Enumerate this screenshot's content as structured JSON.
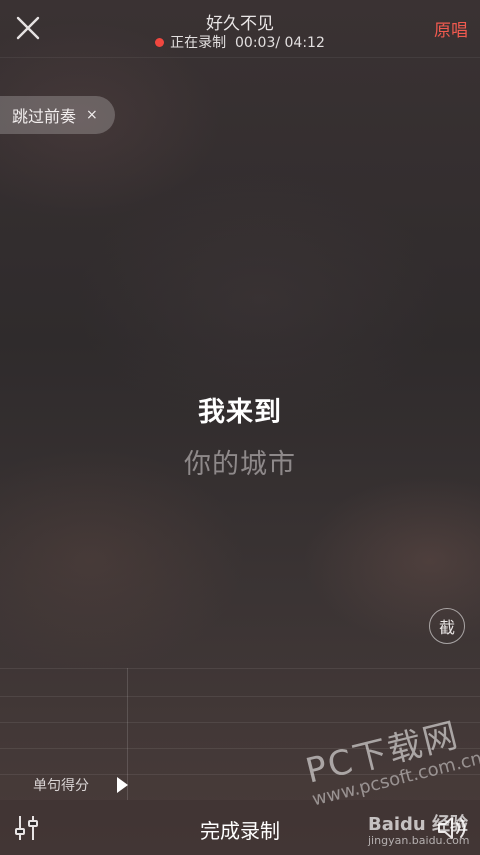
{
  "header": {
    "title": "好久不见",
    "status_label": "正在录制",
    "time_display": "00:03/ 04:12",
    "original_label": "原唱"
  },
  "skip_intro": {
    "label": "跳过前奏",
    "close_glyph": "×"
  },
  "lyrics": {
    "current": "我来到",
    "next": "你的城市"
  },
  "screenshot_button": "截",
  "score": {
    "label": "单句得分"
  },
  "footer": {
    "finish_label": "完成录制"
  },
  "watermark": {
    "pc_text": "PC下载网",
    "url_text": "www.pcsoft.com.cn",
    "baidu_text": "Baidu 经验",
    "jingyan_url": "jingyan.baidu.com"
  },
  "icons": {
    "close": "close-icon",
    "tuner": "tuner-sliders-icon",
    "speaker": "speaker-icon",
    "play": "play-arrow-icon"
  },
  "colors": {
    "accent": "#f05a4f",
    "record_dot": "#f0473f"
  }
}
